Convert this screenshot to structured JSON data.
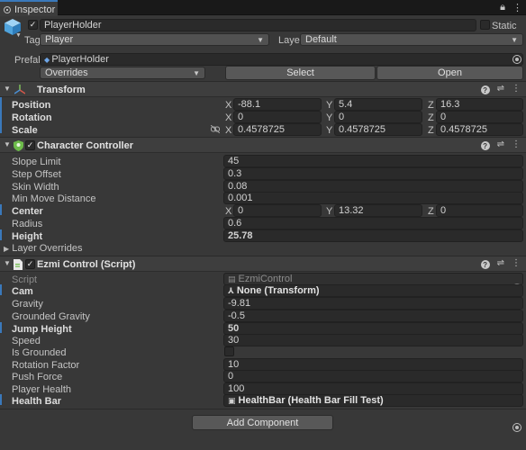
{
  "tabbar": {
    "tab_label": "Inspector",
    "lock_icon": "lock-icon",
    "menu_icon": "kebab-menu-icon"
  },
  "gameobject": {
    "name": "PlayerHolder",
    "static_label": "Static",
    "tag_label": "Tag",
    "tag_value": "Player",
    "layer_label": "Layer",
    "layer_value": "Default",
    "prefab_label": "Prefab",
    "prefab_value": "PlayerHolder",
    "overrides_label": "Overrides",
    "select_label": "Select",
    "open_label": "Open"
  },
  "transform": {
    "title": "Transform",
    "rows": [
      {
        "label": "Position",
        "x": "-88.1",
        "y": "5.4",
        "z": "16.3"
      },
      {
        "label": "Rotation",
        "x": "0",
        "y": "0",
        "z": "0"
      },
      {
        "label": "Scale",
        "x": "0.4578725",
        "y": "0.4578725",
        "z": "0.4578725"
      }
    ],
    "axis_labels": {
      "x": "X",
      "y": "Y",
      "z": "Z"
    }
  },
  "character_controller": {
    "title": "Character Controller",
    "rows": [
      {
        "label": "Slope Limit",
        "value": "45"
      },
      {
        "label": "Step Offset",
        "value": "0.3"
      },
      {
        "label": "Skin Width",
        "value": "0.08"
      },
      {
        "label": "Min Move Distance",
        "value": "0.001"
      }
    ],
    "center_label": "Center",
    "center": {
      "x": "0",
      "y": "13.32",
      "z": "0"
    },
    "radius_label": "Radius",
    "radius_value": "0.6",
    "height_label": "Height",
    "height_value": "25.78",
    "layer_overrides_label": "Layer Overrides"
  },
  "ezmi_control": {
    "title": "Ezmi Control (Script)",
    "script_label": "Script",
    "script_value": "EzmiControl",
    "cam_label": "Cam",
    "cam_value": "None (Transform)",
    "rows": [
      {
        "label": "Gravity",
        "value": "-9.81"
      },
      {
        "label": "Grounded Gravity",
        "value": "-0.5"
      }
    ],
    "jump_label": "Jump Height",
    "jump_value": "50",
    "speed_label": "Speed",
    "speed_value": "30",
    "grounded_label": "Is Grounded",
    "rows2": [
      {
        "label": "Rotation Factor",
        "value": "10"
      },
      {
        "label": "Push Force",
        "value": "0"
      },
      {
        "label": "Player Health",
        "value": "100"
      }
    ],
    "health_bar_label": "Health Bar",
    "health_bar_value": "HealthBar (Health Bar Fill Test)"
  },
  "add_component_label": "Add Component"
}
